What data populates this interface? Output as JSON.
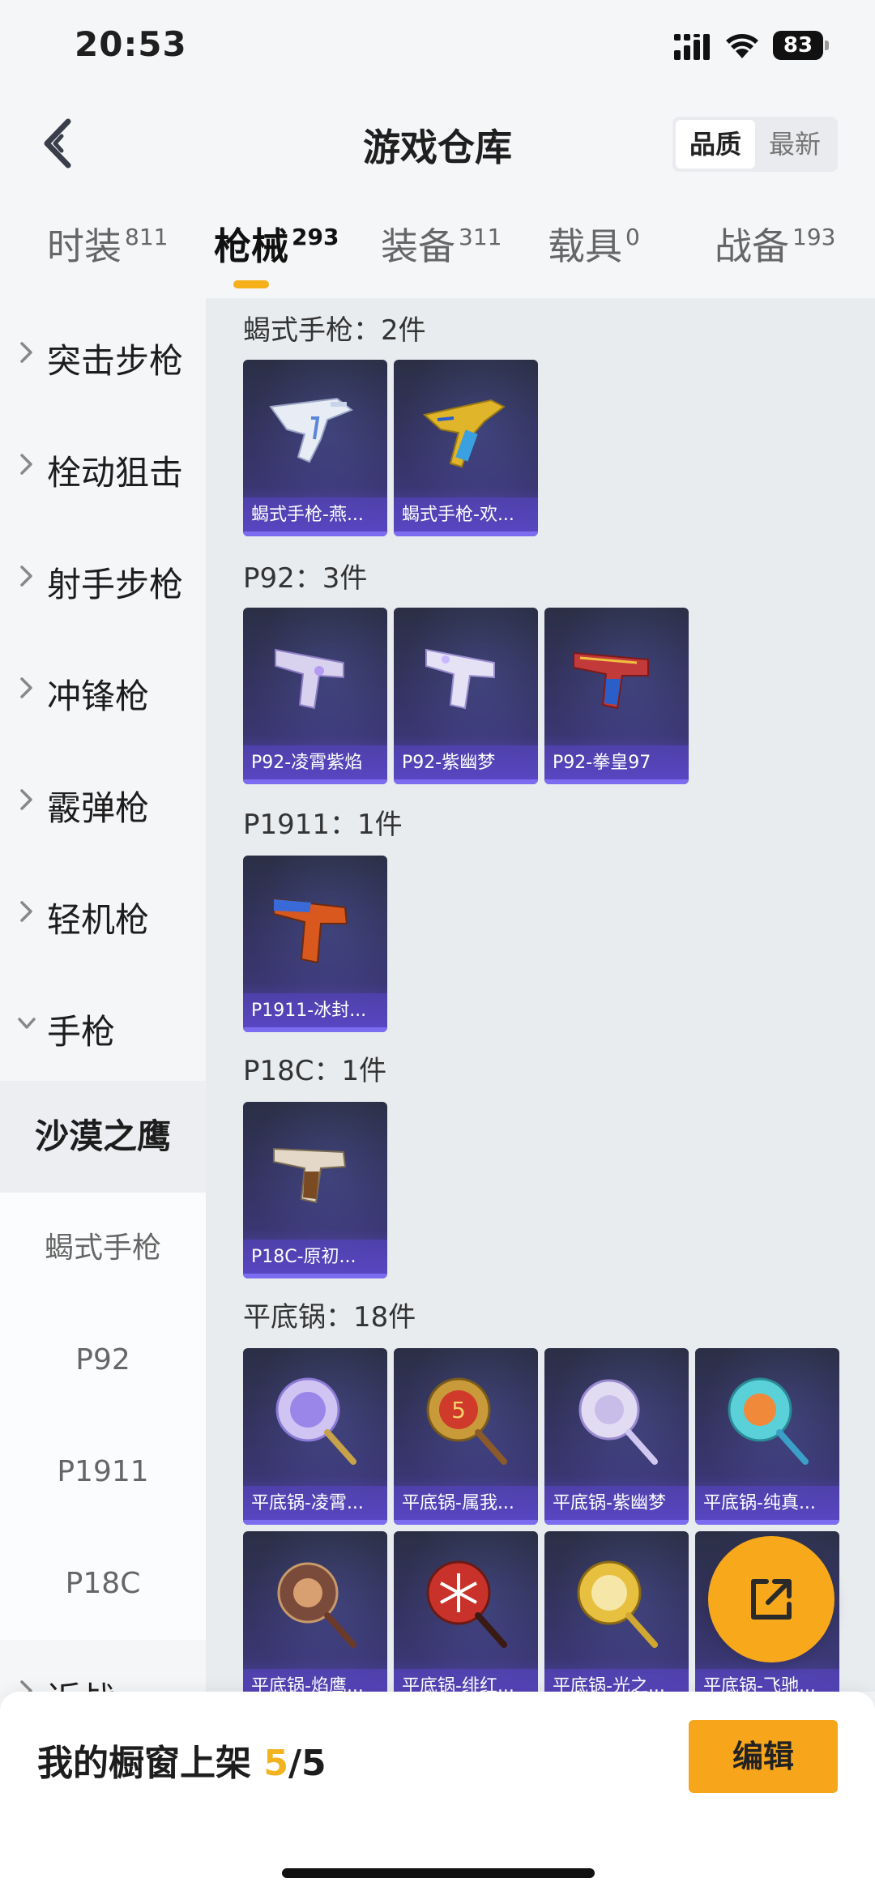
{
  "status_bar": {
    "time": "20:53",
    "battery": "83"
  },
  "header": {
    "title": "游戏仓库",
    "sort": {
      "quality": "品质",
      "latest": "最新",
      "selected": "品质"
    }
  },
  "tabs": [
    {
      "label": "时装",
      "count": "811"
    },
    {
      "label": "枪械",
      "count": "293",
      "active": true
    },
    {
      "label": "装备",
      "count": "311"
    },
    {
      "label": "载具",
      "count": "0"
    },
    {
      "label": "战备",
      "count": "193"
    }
  ],
  "sidebar": {
    "categories": [
      "突击步枪",
      "栓动狙击",
      "射手步枪",
      "冲锋枪",
      "霰弹枪",
      "轻机枪",
      "手枪"
    ],
    "subcategories": [
      "沙漠之鹰",
      "蝎式手枪",
      "P92",
      "P1911",
      "P18C"
    ],
    "next_category_partial": "近战"
  },
  "groups": [
    {
      "title": "蝎式手枪：2件",
      "items": [
        "蝎式手枪-燕...",
        "蝎式手枪-欢..."
      ]
    },
    {
      "title": "P92：3件",
      "items": [
        "P92-凌霄紫焰",
        "P92-紫幽梦",
        "P92-拳皇97"
      ]
    },
    {
      "title": "P1911：1件",
      "items": [
        "P1911-冰封..."
      ]
    },
    {
      "title": "P18C：1件",
      "items": [
        "P18C-原初..."
      ]
    },
    {
      "title": "平底锅：18件",
      "items": [
        "平底锅-凌霄...",
        "平底锅-属我...",
        "平底锅-紫幽梦",
        "平底锅-纯真...",
        "平底锅-焰鹰...",
        "平底锅-绯红...",
        "平底锅-光之...",
        "平底锅-飞驰..."
      ]
    }
  ],
  "bottom_bar": {
    "label": "我的橱窗上架",
    "count_current": "5",
    "count_separator": "/",
    "count_total": "5",
    "edit_label": "编辑"
  },
  "colors": {
    "accent": "#f7a51b",
    "card_top": "#2b2f45",
    "card_bottom": "#5c49c2"
  }
}
